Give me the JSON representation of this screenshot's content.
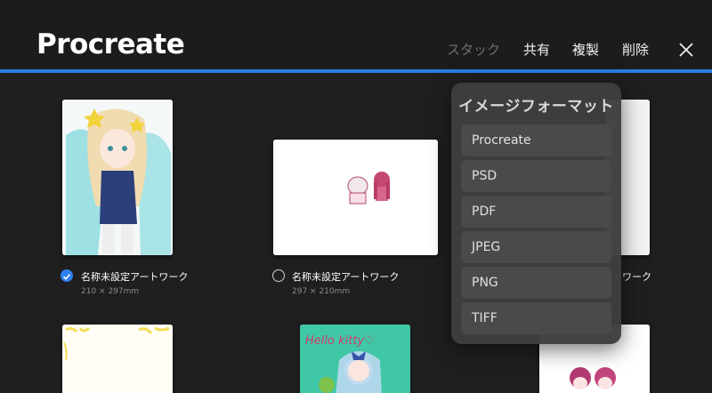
{
  "app": {
    "title": "Procreate"
  },
  "toolbar": {
    "stack_label": "スタック",
    "share_label": "共有",
    "duplicate_label": "複製",
    "delete_label": "削除"
  },
  "colors": {
    "accent": "#2a7de1",
    "background": "#1f1f1f",
    "popover": "#3e3e3e"
  },
  "gallery": {
    "items": [
      {
        "title": "名称未設定アートワーク",
        "size": "210 × 297mm",
        "selected": true
      },
      {
        "title": "名称未設定アートワーク",
        "size": "297 × 210mm",
        "selected": false
      },
      {
        "title": "トワーク",
        "size": "",
        "selected": false
      }
    ]
  },
  "share_menu": {
    "title": "イメージフォーマット",
    "formats": [
      "Procreate",
      "PSD",
      "PDF",
      "JPEG",
      "PNG",
      "TIFF"
    ]
  }
}
